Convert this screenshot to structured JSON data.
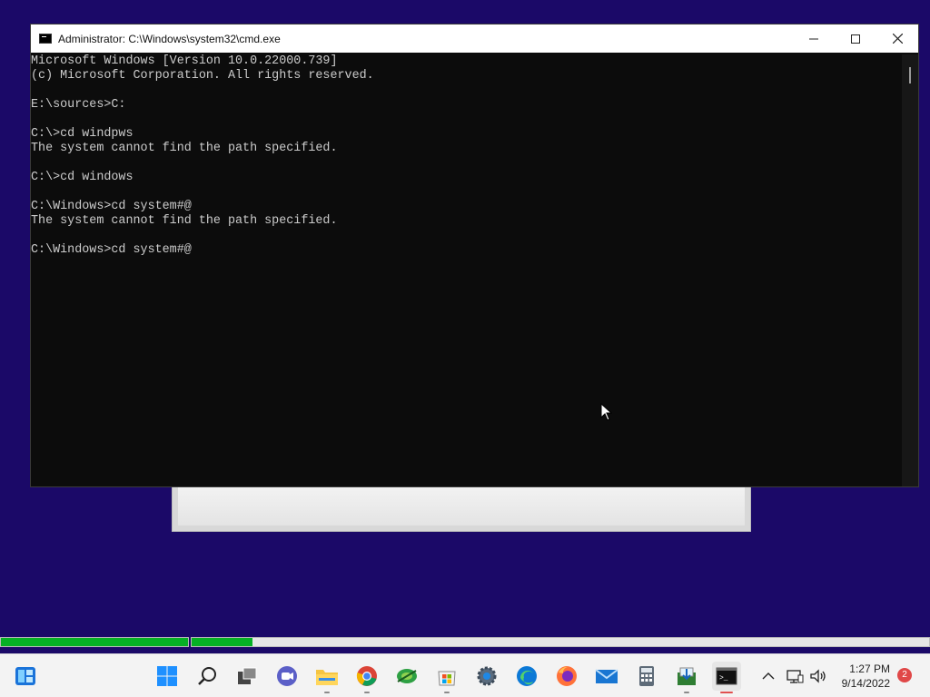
{
  "window": {
    "title": "Administrator: C:\\Windows\\system32\\cmd.exe",
    "minimize_glyph": "─",
    "maximize_glyph": "☐",
    "close_glyph": "✕"
  },
  "console": {
    "lines": [
      "Microsoft Windows [Version 10.0.22000.739]",
      "(c) Microsoft Corporation. All rights reserved.",
      "",
      "E:\\sources>C:",
      "",
      "C:\\>cd windpws",
      "The system cannot find the path specified.",
      "",
      "C:\\>cd windows",
      "",
      "C:\\Windows>cd system#@",
      "The system cannot find the path specified.",
      "",
      "C:\\Windows>cd system#@"
    ]
  },
  "progress": {
    "bar1": 1.0,
    "bar2": 0.083
  },
  "taskbar": {
    "apps": [
      {
        "name": "widgets-icon"
      },
      {
        "name": "start-icon"
      },
      {
        "name": "search-icon"
      },
      {
        "name": "task-view-icon"
      },
      {
        "name": "teams-chat-icon"
      },
      {
        "name": "file-explorer-icon"
      },
      {
        "name": "chrome-icon"
      },
      {
        "name": "app-green-icon"
      },
      {
        "name": "microsoft-store-icon"
      },
      {
        "name": "settings-icon"
      },
      {
        "name": "edge-icon"
      },
      {
        "name": "firefox-icon"
      },
      {
        "name": "mail-icon"
      },
      {
        "name": "calculator-icon"
      },
      {
        "name": "app-installer-icon"
      },
      {
        "name": "command-prompt-icon"
      }
    ],
    "tray": {
      "chevron": "^",
      "time": "1:27 PM",
      "date": "9/14/2022",
      "notifications": "2"
    }
  },
  "colors": {
    "desktop": "#1b0968",
    "console_bg": "#0c0c0c",
    "console_text": "#cccccc",
    "progress_fill": "#06b025"
  }
}
